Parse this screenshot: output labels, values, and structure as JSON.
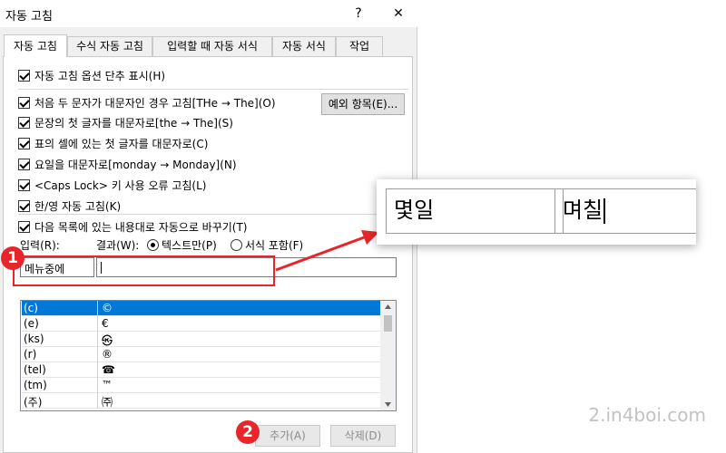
{
  "window": {
    "title": "자동 고침",
    "help_label": "?",
    "close_label": "✕"
  },
  "tabs": [
    "자동 고침",
    "수식 자동 고침",
    "입력할 때 자동 서식",
    "자동 서식",
    "작업"
  ],
  "options": {
    "show_buttons": "자동 고침 옵션 단추 표시(H)",
    "two_initial_caps": "처음 두 문자가 대문자인 경우 고침[THe → The](O)",
    "first_letter_sentence": "문장의 첫 글자를 대문자로[the → The](S)",
    "first_letter_table_cell": "표의 셀에 있는 첫 글자를 대문자로(C)",
    "capitalize_days": "요일을 대문자로[monday → Monday](N)",
    "caps_lock": "<Caps Lock> 키 사용 오류 고침(L)",
    "han_eng": "한/영 자동 고침(K)",
    "replace_as_you_type": "다음 목록에 있는 내용대로 자동으로 바꾸기(T)"
  },
  "exceptions_button": "예외 항목(E)...",
  "replace": {
    "input_label": "입력(R):",
    "result_label": "결과(W):",
    "plain_text": "텍스트만(P)",
    "formatted_text": "서식 포함(F)",
    "input_value": "메뉴중에",
    "result_value": ""
  },
  "entries": [
    {
      "from": "(c)",
      "to": "©"
    },
    {
      "from": "(e)",
      "to": "€"
    },
    {
      "from": "(ks)",
      "to": "㉿"
    },
    {
      "from": "(r)",
      "to": "®"
    },
    {
      "from": "(tel)",
      "to": "☎"
    },
    {
      "from": "(tm)",
      "to": "™"
    },
    {
      "from": "(주)",
      "to": "㈜"
    }
  ],
  "buttons": {
    "add": "추가(A)",
    "delete": "삭제(D)"
  },
  "markers": {
    "one": "1",
    "two": "2"
  },
  "zoom": {
    "input": "몇일",
    "result": "며칠"
  },
  "watermark": "2.in4boi.com",
  "colors": {
    "marker": "#e8262a",
    "selection": "#0078d7"
  }
}
